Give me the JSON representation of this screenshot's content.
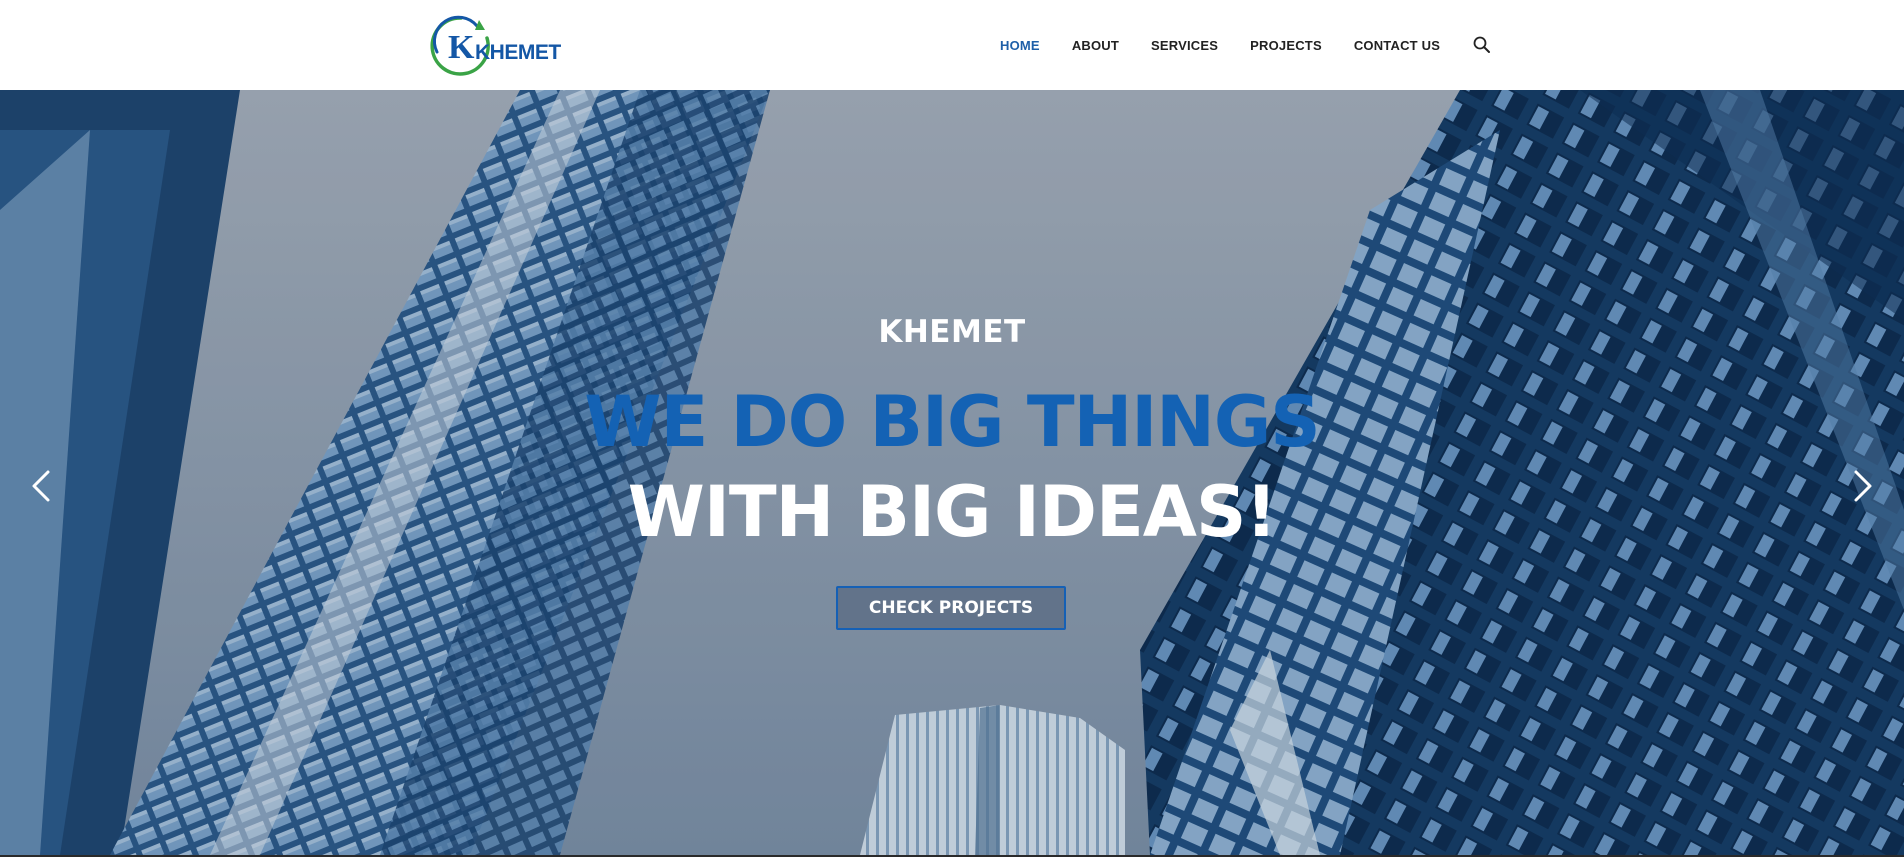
{
  "header": {
    "logo": {
      "mark": "K",
      "wordmark": "KHEMET"
    },
    "nav": [
      {
        "label": "HOME",
        "active": true
      },
      {
        "label": "ABOUT",
        "active": false
      },
      {
        "label": "SERVICES",
        "active": false
      },
      {
        "label": "PROJECTS",
        "active": false
      },
      {
        "label": "CONTACT US",
        "active": false
      }
    ],
    "search_icon": "search-icon"
  },
  "hero": {
    "eyebrow": "KHEMET",
    "headline_line1": "WE DO BIG THINGS",
    "headline_line2": "WITH BIG IDEAS!",
    "cta_label": "CHECK PROJECTS",
    "prev_icon": "chevron-left-icon",
    "next_icon": "chevron-right-icon"
  },
  "colors": {
    "brand_blue": "#1462b4",
    "nav_active": "#1e5fa8",
    "nav_text": "#222222",
    "logo_green": "#3aa346"
  }
}
